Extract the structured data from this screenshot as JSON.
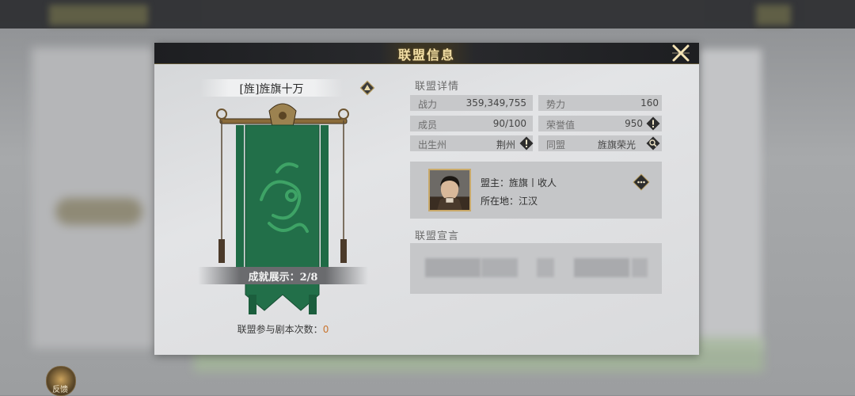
{
  "background": {
    "feedback_label": "反馈"
  },
  "dialog": {
    "title": "联盟信息",
    "close_icon": "close-x-icon",
    "alliance_name": "[旌]旌旗十万",
    "achievement_label": "成就展示：2/8",
    "raid_count_label": "联盟参与剧本次数：",
    "raid_count_value": "0",
    "details_heading": "联盟详情",
    "stats": [
      {
        "label": "战力",
        "value": "359,349,755"
      },
      {
        "label": "势力",
        "value": "160"
      },
      {
        "label": "成员",
        "value": "90/100"
      },
      {
        "label": "荣誉值",
        "value": "950"
      },
      {
        "label": "出生州",
        "value": "荆州"
      },
      {
        "label": "同盟",
        "value": "旌旗荣光"
      }
    ],
    "leader": {
      "title_line": "盟主：旌旗丨收人",
      "location_line": "所在地：江汉"
    },
    "declaration_heading": "联盟宣言"
  },
  "colors": {
    "title_gold": "#f3dfa6",
    "banner_green": "#1f6b46",
    "count_orange": "#c8742e"
  }
}
